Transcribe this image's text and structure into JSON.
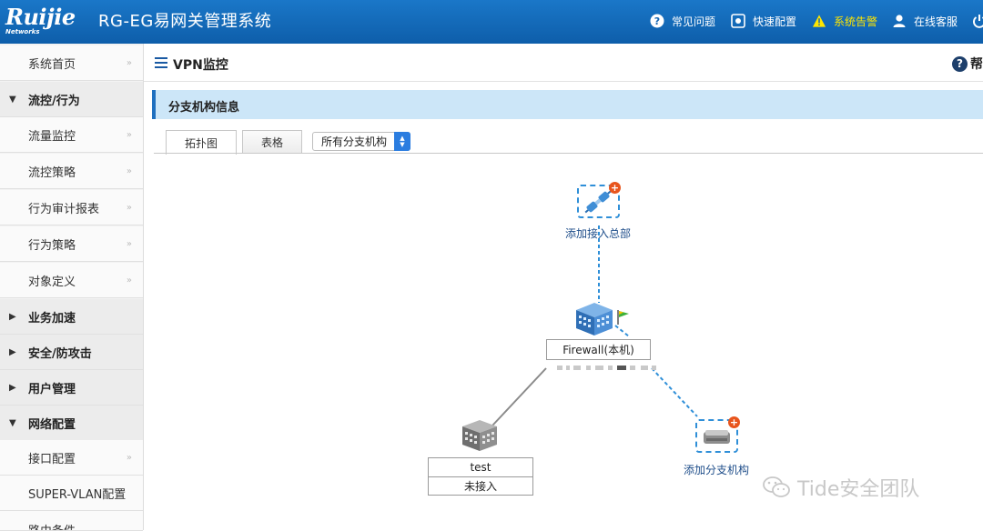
{
  "header": {
    "logo_text": "Ruijie",
    "logo_sub": "Networks",
    "system_title": "RG-EG易网关管理系统",
    "items": [
      {
        "label": "常见问题",
        "icon": "question-circle-icon"
      },
      {
        "label": "快速配置",
        "icon": "settings-box-icon"
      },
      {
        "label": "系统告警",
        "icon": "warning-triangle-icon"
      },
      {
        "label": "在线客服",
        "icon": "user-icon"
      }
    ],
    "accent_color": "#1a77c8",
    "alarm_color": "#ffe600"
  },
  "sidebar": {
    "items": [
      {
        "label": "系统首页",
        "type": "item"
      },
      {
        "label": "流控/行为",
        "type": "group",
        "expanded": true
      },
      {
        "label": "流量监控",
        "type": "item"
      },
      {
        "label": "流控策略",
        "type": "item"
      },
      {
        "label": "行为审计报表",
        "type": "item"
      },
      {
        "label": "行为策略",
        "type": "item"
      },
      {
        "label": "对象定义",
        "type": "item"
      },
      {
        "label": "业务加速",
        "type": "group",
        "expanded": false
      },
      {
        "label": "安全/防攻击",
        "type": "group",
        "expanded": false
      },
      {
        "label": "用户管理",
        "type": "group",
        "expanded": false
      },
      {
        "label": "网络配置",
        "type": "group",
        "expanded": true
      },
      {
        "label": "接口配置",
        "type": "item"
      },
      {
        "label": "SUPER-VLAN配置",
        "type": "item"
      },
      {
        "label": "路由条件",
        "type": "item"
      }
    ],
    "chevron": "»"
  },
  "page": {
    "title": "VPN监控",
    "help_label": "帮",
    "section_title": "分支机构信息",
    "tabs": [
      {
        "label": "拓扑图",
        "active": true
      },
      {
        "label": "表格",
        "active": false
      }
    ],
    "branch_select": {
      "value": "所有分支机构"
    }
  },
  "topology": {
    "add_hq_label": "添加接入总部",
    "firewall_label": "Firewall(本机)",
    "branch_name": "test",
    "branch_status": "未接入",
    "add_branch_label": "添加分支机构"
  },
  "watermark": "Tide安全团队"
}
